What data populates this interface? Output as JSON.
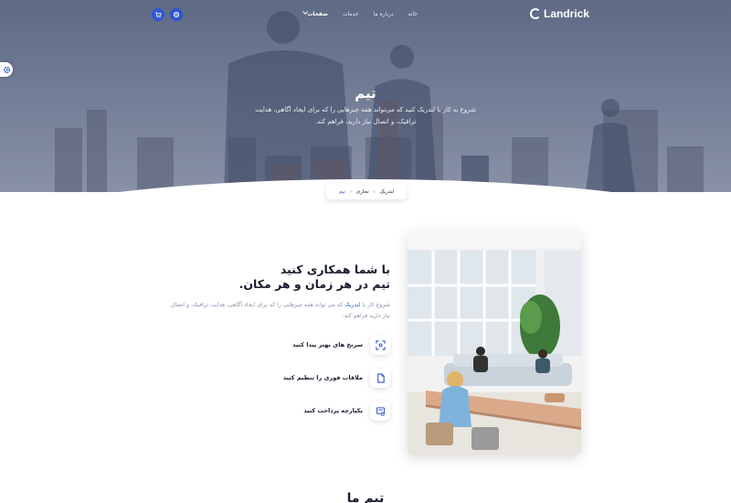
{
  "brand": {
    "name": "Landrick"
  },
  "nav": {
    "items": [
      {
        "label": "خانه"
      },
      {
        "label": "درباره ما"
      },
      {
        "label": "خدمات"
      },
      {
        "label": "صفحات"
      }
    ],
    "cart_icon": "cart-icon",
    "settings_icon": "gear-icon"
  },
  "hero": {
    "title": "تیم",
    "description": "شروع به کار با لندریک کنید که می‌تواند همه چیزهایی را که برای ایجاد آگاهی، هدایت ترافیک، و اتصال نیاز دارید، فراهم کند."
  },
  "breadcrumb": [
    {
      "label": "لندریک"
    },
    {
      "label": "تجاری"
    },
    {
      "label": "تیم"
    }
  ],
  "about": {
    "heading_line1": "با شما همکاری کنید",
    "heading_line2": "تیم در هر زمان و هر مکان.",
    "lead_prefix": "شروع کار با ",
    "lead_brand": "لندریک",
    "lead_rest": " که می تواند همه چیزهایی را که برای ایجاد آگاهی، هدایت ترافیک، و اتصال نیاز دارید فراهم کند.",
    "features": [
      {
        "label": "سرنخ های بهتر پیدا کنید",
        "icon": "scan-icon"
      },
      {
        "label": "ملاقات فوری را تنظیم کنید",
        "icon": "document-icon"
      },
      {
        "label": "یکپارچه پرداخت کنید",
        "icon": "invoice-icon"
      }
    ]
  },
  "team_section": {
    "title": "تیم ما"
  },
  "colors": {
    "primary": "#2f55d4",
    "text": "#161c2d",
    "muted": "#8492a6"
  }
}
